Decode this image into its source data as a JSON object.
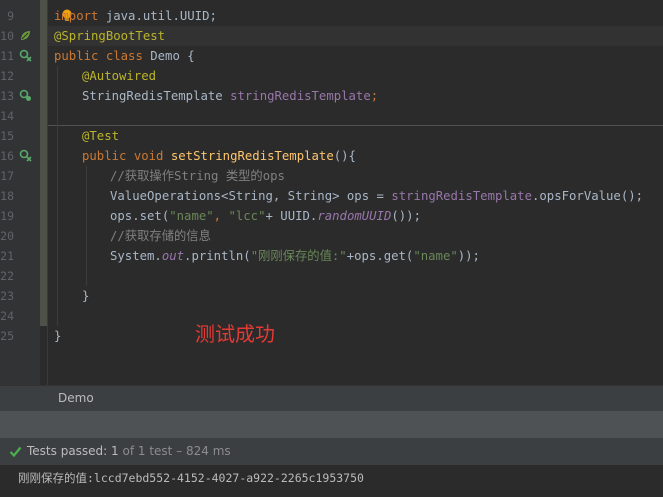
{
  "editor": {
    "line_numbers": [
      "9",
      "10",
      "11",
      "12",
      "13",
      "14",
      "15",
      "16",
      "17",
      "18",
      "19",
      "20",
      "21",
      "22",
      "23",
      "24",
      "25"
    ],
    "lines": {
      "l9": {
        "kw": "import",
        "rest": " java.util.UUID;"
      },
      "l10": {
        "ann": "@SpringBootTest"
      },
      "l11": {
        "kw1": "public",
        "kw2": " class",
        "rest": " Demo {"
      },
      "l12": {
        "ann": "@Autowired"
      },
      "l13": {
        "type": "StringRedisTemplate ",
        "field": "stringRedisTemplate",
        "tail": ";"
      },
      "l15": {
        "ann": "@Test"
      },
      "l16": {
        "kw1": "public",
        "kw2": " void",
        "fn": " setStringRedisTemplate",
        "tail": "(){"
      },
      "l17": {
        "comment": "//获取操作String 类型的ops"
      },
      "l18": {
        "a": "ValueOperations<String, String> ops = ",
        "field": "stringRedisTemplate",
        "b": ".opsForValue();"
      },
      "l19": {
        "a": "ops.set(",
        "s1": "\"name\"",
        "b": ", ",
        "s2": "\"lcc\"",
        "c": "+ UUID.",
        "it": "randomUUID",
        "d": "());"
      },
      "l20": {
        "comment": "//获取存储的信息"
      },
      "l21": {
        "a": "System.",
        "it": "out",
        "b": ".println(",
        "s1": "\"刚刚保存的值:\"",
        "c": "+ops.get(",
        "s2": "\"name\"",
        "d": "));"
      },
      "l23": {
        "text": "}"
      },
      "l25": {
        "text": "}"
      }
    },
    "overlay_label": "测试成功"
  },
  "bottom_panel": {
    "tab_label": "Demo",
    "status": {
      "passed_label": "Tests passed:",
      "count": "1",
      "of_text": "of 1 test – 824 ms"
    },
    "console_output": "刚刚保存的值:lccd7ebd552-4152-4027-a922-2265c1953750"
  },
  "colors": {
    "keyword": "#cc7832",
    "annotation": "#bbb529",
    "field": "#9876aa",
    "method": "#ffc66d",
    "string": "#6a8759",
    "comment": "#808080",
    "overlay": "#e53935",
    "passed": "#4caf50"
  },
  "icons": [
    "run-spring-icon",
    "run-test-icon",
    "bean-autowired-icon",
    "intention-bulb-icon",
    "passed-check-icon"
  ]
}
